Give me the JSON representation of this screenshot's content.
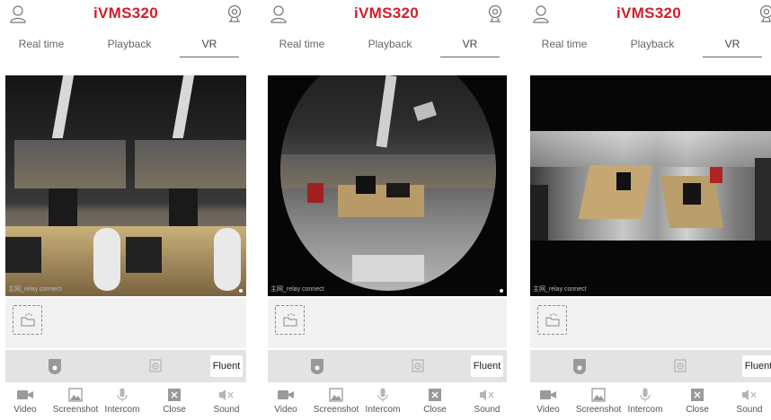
{
  "screens": [
    {
      "header": {
        "title": "iVMS320"
      },
      "tabs": [
        {
          "label": "Real time"
        },
        {
          "label": "Playback"
        },
        {
          "label": "VR"
        }
      ],
      "video": {
        "overlay_text": "主网_relay connect",
        "mode": "dual-panorama"
      },
      "quality": {
        "label": "Fluent"
      },
      "toolbar": [
        {
          "label": "Video"
        },
        {
          "label": "Screenshot"
        },
        {
          "label": "Intercom"
        },
        {
          "label": "Close"
        },
        {
          "label": "Sound"
        }
      ]
    },
    {
      "header": {
        "title": "iVMS320"
      },
      "tabs": [
        {
          "label": "Real time"
        },
        {
          "label": "Playback"
        },
        {
          "label": "VR"
        }
      ],
      "video": {
        "overlay_text": "主网_relay connect",
        "mode": "fisheye"
      },
      "quality": {
        "label": "Fluent"
      },
      "toolbar": [
        {
          "label": "Video"
        },
        {
          "label": "Screenshot"
        },
        {
          "label": "Intercom"
        },
        {
          "label": "Close"
        },
        {
          "label": "Sound"
        }
      ]
    },
    {
      "header": {
        "title": "iVMS320"
      },
      "tabs": [
        {
          "label": "Real time"
        },
        {
          "label": "Playback"
        },
        {
          "label": "VR"
        }
      ],
      "video": {
        "overlay_text": "主网_relay connect",
        "mode": "panorama-strip"
      },
      "quality": {
        "label": "Fluent"
      },
      "toolbar": [
        {
          "label": "Video"
        },
        {
          "label": "Screenshot"
        },
        {
          "label": "Intercom"
        },
        {
          "label": "Close"
        },
        {
          "label": "Sound"
        }
      ]
    }
  ],
  "active_tab": "VR",
  "icons": {
    "header_left": "user-icon",
    "header_right": "camera-icon",
    "thumbnail": "folder-icon",
    "control_left": "ptz-camera-icon",
    "control_middle": "fisheye-icon",
    "toolbar": [
      "video-record-icon",
      "screenshot-icon",
      "microphone-icon",
      "close-box-icon",
      "sound-mute-icon"
    ]
  },
  "colors": {
    "brand": "#d01f2a",
    "control_bar": "#e3e3e3",
    "thumb_bar": "#f2f2f2"
  }
}
